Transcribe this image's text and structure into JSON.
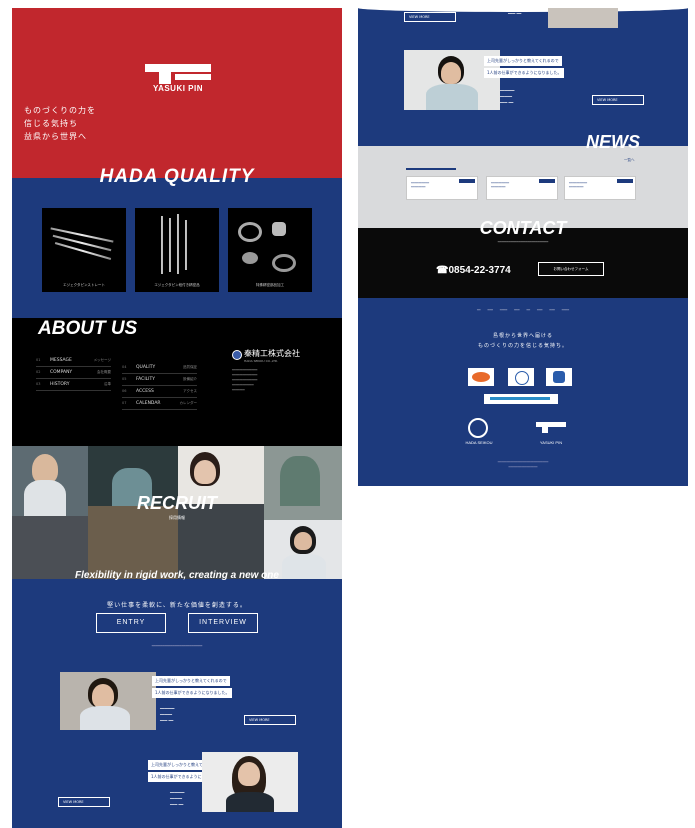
{
  "hero": {
    "brand": "YASUKI PIN",
    "copy_lines": [
      "ものづくりの力を",
      "信じる気持ち",
      "益県から世界へ"
    ],
    "color": "#c1272d"
  },
  "quality": {
    "title": "HADA QUALITY",
    "products": [
      "エジェクタピンストレート",
      "エジェクタピン段付き精密品",
      "特殊精密部品加工"
    ]
  },
  "about": {
    "title": "ABOUT US",
    "menu_left": [
      {
        "num": "01",
        "label": "MESSAGE",
        "jp": "メッセージ"
      },
      {
        "num": "02",
        "label": "COMPANY",
        "jp": "会社概要"
      },
      {
        "num": "03",
        "label": "HISTORY",
        "jp": "沿革"
      }
    ],
    "menu_right": [
      {
        "num": "04",
        "label": "QUALITY",
        "jp": "品質保証"
      },
      {
        "num": "05",
        "label": "FACILITY",
        "jp": "設備紹介"
      },
      {
        "num": "06",
        "label": "ACCESS",
        "jp": "アクセス"
      },
      {
        "num": "07",
        "label": "CALENDAR",
        "jp": "カレンダー"
      }
    ],
    "company_name": "秦精工株式会社",
    "company_sub": "HADA SEIKOU CO.,LTD."
  },
  "recruit": {
    "title": "RECRUIT",
    "subtitle": "採用情報",
    "tagline": "Flexibility in rigid work, creating a new one",
    "jp_line": "堅い仕事を柔軟に、新たな価値を創造する。",
    "entry_label": "ENTRY",
    "interview_label": "INTERVIEW"
  },
  "interviews": [
    {
      "caption1": "上司先輩がしっかりと教えてくれるので",
      "caption2": "1人前の仕事ができるようになりました。",
      "btn": "VIEW MORE"
    },
    {
      "caption1": "上司先輩がしっかりと教えてくれるので",
      "caption2": "1人前の仕事ができるようになりました。",
      "btn": "VIEW MORE"
    },
    {
      "caption1": "上司先輩がしっかりと教えてくれるので",
      "caption2": "1人前の仕事ができるようになりました。",
      "btn": "VIEW MORE"
    }
  ],
  "news": {
    "title": "NEWS",
    "more": "一覧へ"
  },
  "contact": {
    "title": "CONTACT",
    "phone": "0854-22-3774",
    "form_label": "お問い合わせフォーム"
  },
  "footer": {
    "line1": "島根から世界へ届ける",
    "line2": "ものづくりの力を信じる気持ち。",
    "logo1": "HADA SEIKOU",
    "logo2": "YASUKI PIN"
  }
}
